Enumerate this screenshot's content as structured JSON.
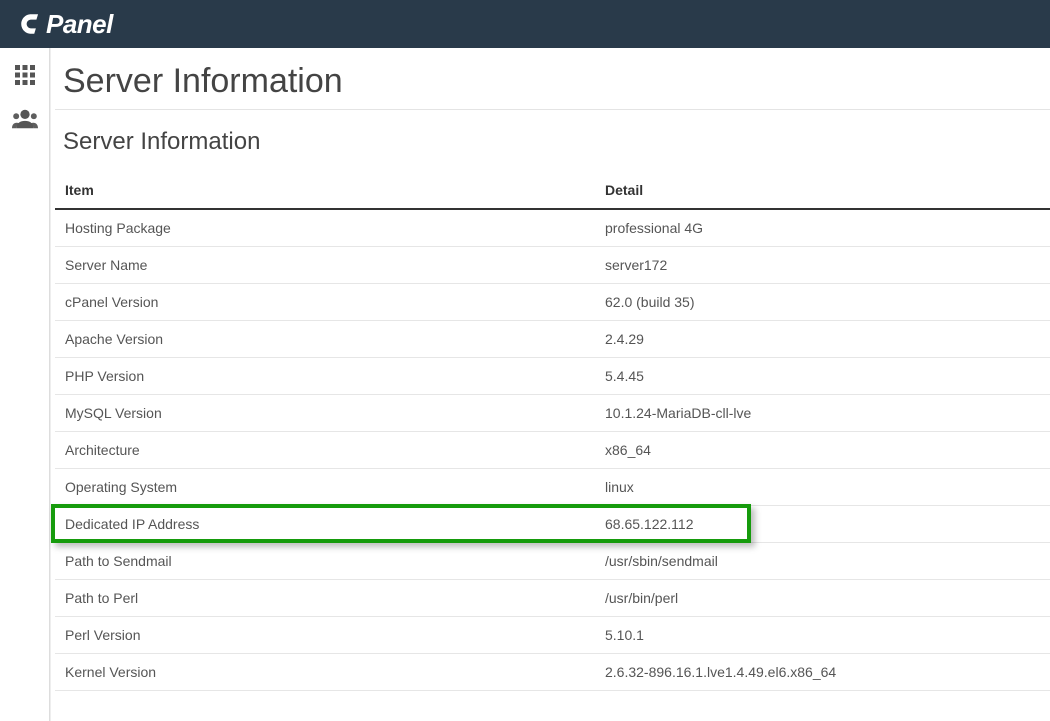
{
  "header": {
    "logo_text": "Panel"
  },
  "page": {
    "title": "Server Information",
    "section_title": "Server Information"
  },
  "table": {
    "headers": {
      "item": "Item",
      "detail": "Detail"
    },
    "rows": [
      {
        "item": "Hosting Package",
        "detail": "professional 4G"
      },
      {
        "item": "Server Name",
        "detail": "server172"
      },
      {
        "item": "cPanel Version",
        "detail": "62.0 (build 35)"
      },
      {
        "item": "Apache Version",
        "detail": "2.4.29"
      },
      {
        "item": "PHP Version",
        "detail": "5.4.45"
      },
      {
        "item": "MySQL Version",
        "detail": "10.1.24-MariaDB-cll-lve"
      },
      {
        "item": "Architecture",
        "detail": "x86_64"
      },
      {
        "item": "Operating System",
        "detail": "linux"
      },
      {
        "item": "Dedicated IP Address",
        "detail": "68.65.122.112"
      },
      {
        "item": "Path to Sendmail",
        "detail": "/usr/sbin/sendmail"
      },
      {
        "item": "Path to Perl",
        "detail": "/usr/bin/perl"
      },
      {
        "item": "Perl Version",
        "detail": "5.10.1"
      },
      {
        "item": "Kernel Version",
        "detail": "2.6.32-896.16.1.lve1.4.49.el6.x86_64"
      }
    ],
    "highlighted_row_index": 8
  }
}
